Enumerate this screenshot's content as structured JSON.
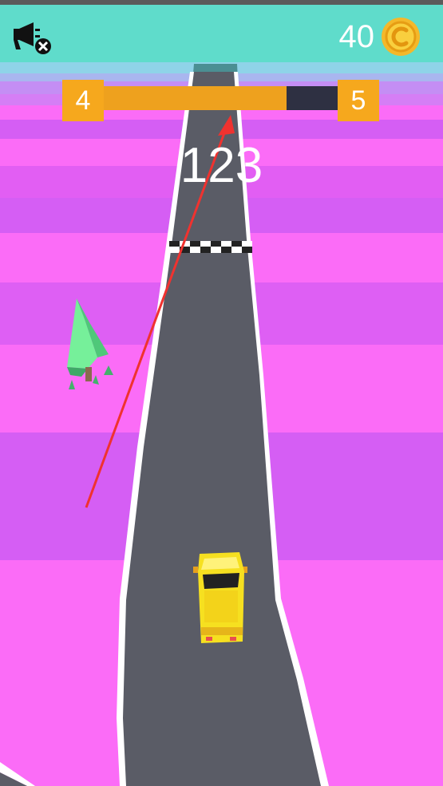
{
  "hud": {
    "coins": "40",
    "level_current": "4",
    "level_next": "5",
    "level_progress": 0.78,
    "score": "123"
  },
  "icons": {
    "no_ads": "megaphone-with-x-icon",
    "coin": "gold-coin-icon"
  },
  "colors": {
    "hud_bar": "#5fdccb",
    "progress_fill": "#eea11e",
    "level_box": "#f6a81d",
    "road": "#5a5c66",
    "ground_light": "#fb6cf7",
    "ground_dark": "#d55ef4",
    "car": "#f6e020",
    "tree": "#5fe08a",
    "hint_arrow": "#f0322f"
  }
}
